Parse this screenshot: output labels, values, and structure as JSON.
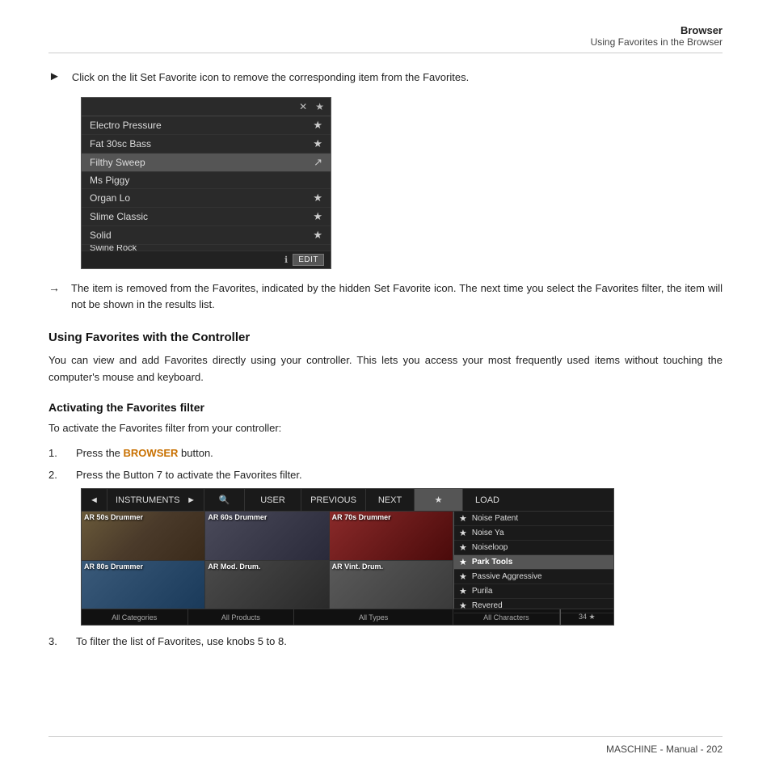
{
  "header": {
    "title": "Browser",
    "subtitle": "Using Favorites in the Browser"
  },
  "intro_bullet": {
    "arrow": "►",
    "text": "Click on the lit Set Favorite icon to remove the corresponding item from the Favorites."
  },
  "favorites_list": {
    "items": [
      {
        "name": "Electro Pressure",
        "has_star": true,
        "highlighted": false
      },
      {
        "name": "Fat 30sc Bass",
        "has_star": true,
        "highlighted": false
      },
      {
        "name": "Filthy Sweep",
        "has_star": false,
        "highlighted": true
      },
      {
        "name": "Ms Piggy",
        "has_star": false,
        "highlighted": false
      },
      {
        "name": "Organ Lo",
        "has_star": true,
        "highlighted": false
      },
      {
        "name": "Slime Classic",
        "has_star": true,
        "highlighted": false
      },
      {
        "name": "Solid",
        "has_star": true,
        "highlighted": false
      },
      {
        "name": "Swine Rock",
        "has_star": false,
        "highlighted": false,
        "partial": true
      }
    ],
    "edit_label": "EDIT"
  },
  "result": {
    "arrow": "→",
    "text": "The item is removed from the Favorites, indicated by the hidden Set Favorite icon. The next time you select the Favorites filter, the item will not be shown in the results list."
  },
  "section1": {
    "heading": "Using Favorites with the Controller",
    "body": "You can view and add Favorites directly using your controller. This lets you access your most frequently used items without touching the computer's mouse and keyboard."
  },
  "section2": {
    "heading": "Activating the Favorites filter",
    "intro": "To activate the Favorites filter from your controller:",
    "steps": [
      {
        "num": "1.",
        "text_before": "Press the ",
        "browser_word": "BROWSER",
        "text_after": " button."
      },
      {
        "num": "2.",
        "text": "Press the Button 7 to activate the Favorites filter."
      }
    ]
  },
  "controller": {
    "toolbar": {
      "left_arrow": "◄",
      "instruments": "INSTRUMENTS",
      "right_arrow": "►",
      "search_icon": "🔍",
      "user": "USER",
      "previous": "PREVIOUS",
      "next": "NEXT",
      "star": "★",
      "load": "LOAD"
    },
    "thumbnails": [
      {
        "label": "AR 50s Drummer",
        "class": "drum1"
      },
      {
        "label": "AR 60s Drummer",
        "class": "drum2"
      },
      {
        "label": "AR 70s Drummer",
        "class": "drum3"
      },
      {
        "label": "AR 80s Drummer",
        "class": "drum4"
      },
      {
        "label": "AR Mod. Drum.",
        "class": "drum5"
      },
      {
        "label": "AR Vint. Drum.",
        "class": "drum6"
      }
    ],
    "fav_items": [
      {
        "name": "Noise Patent",
        "selected": false
      },
      {
        "name": "Noise Ya",
        "selected": false
      },
      {
        "name": "Noiseloop",
        "selected": false
      },
      {
        "name": "Park Tools",
        "selected": true
      },
      {
        "name": "Passive Aggressive",
        "selected": false
      },
      {
        "name": "Purila",
        "selected": false
      },
      {
        "name": "Revered",
        "selected": false
      }
    ],
    "bottom": {
      "all_categories": "All Categories",
      "all_products": "All Products",
      "all_types": "All Types",
      "all_characters": "All Characters",
      "count": "34 ★"
    }
  },
  "step3": {
    "num": "3.",
    "text": "To filter the list of Favorites, use knobs 5 to 8."
  },
  "footer": {
    "text": "MASCHINE - Manual - 202"
  }
}
